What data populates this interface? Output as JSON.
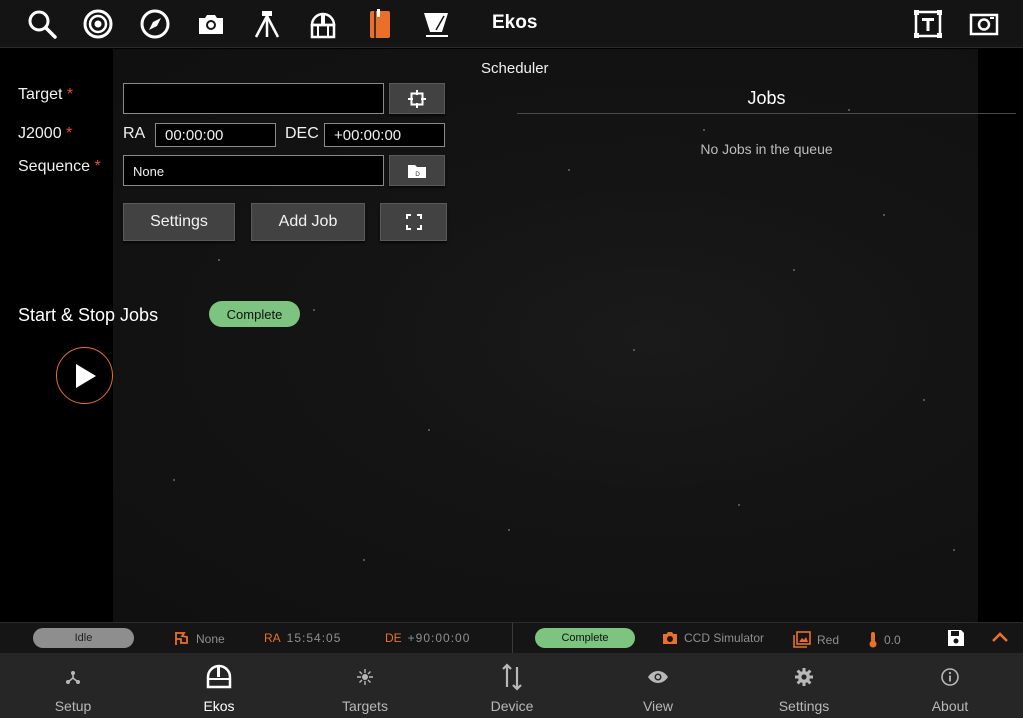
{
  "app": {
    "title": "Ekos"
  },
  "toolbar": {
    "icons": [
      "search-icon",
      "target-icon",
      "compass-icon",
      "camera-icon",
      "tripod-icon",
      "observatory-icon",
      "notebook-icon",
      "flat-light-icon",
      "text-frame-icon",
      "screenshot-icon"
    ]
  },
  "form": {
    "target_label": "Target",
    "j2000_label": "J2000",
    "sequence_label": "Sequence",
    "required_mark": "*",
    "target_value": "",
    "ra_label": "RA",
    "ra_value": "00:00:00",
    "dec_label": "DEC",
    "dec_value": "+00:00:00",
    "sequence_value": "None",
    "settings_button": "Settings",
    "add_job_button": "Add Job"
  },
  "jobs_control": {
    "title": "Start & Stop Jobs",
    "status": "Complete"
  },
  "scheduler": {
    "title": "Scheduler",
    "jobs_heading": "Jobs",
    "empty_text": "No Jobs in the queue"
  },
  "statusbar": {
    "mount_state": "Idle",
    "tracking_target": "None",
    "ra_label": "RA",
    "ra_value": "15:54:05",
    "de_label": "DE",
    "de_value": "+90:00:00",
    "capture_state": "Complete",
    "camera": "CCD Simulator",
    "filter": "Red",
    "temperature": "0.0"
  },
  "bottomnav": {
    "items": [
      {
        "label": "Setup",
        "icon": "setup-icon"
      },
      {
        "label": "Ekos",
        "icon": "ekos-icon"
      },
      {
        "label": "Targets",
        "icon": "targets-icon"
      },
      {
        "label": "Device",
        "icon": "device-icon"
      },
      {
        "label": "View",
        "icon": "view-icon"
      },
      {
        "label": "Settings",
        "icon": "settings-icon"
      },
      {
        "label": "About",
        "icon": "about-icon"
      }
    ],
    "active": "Ekos"
  },
  "colors": {
    "accent_orange": "#e8702a",
    "complete_green": "#7cc47f",
    "idle_gray": "#8e8e8e",
    "required_red": "#e0524a"
  }
}
